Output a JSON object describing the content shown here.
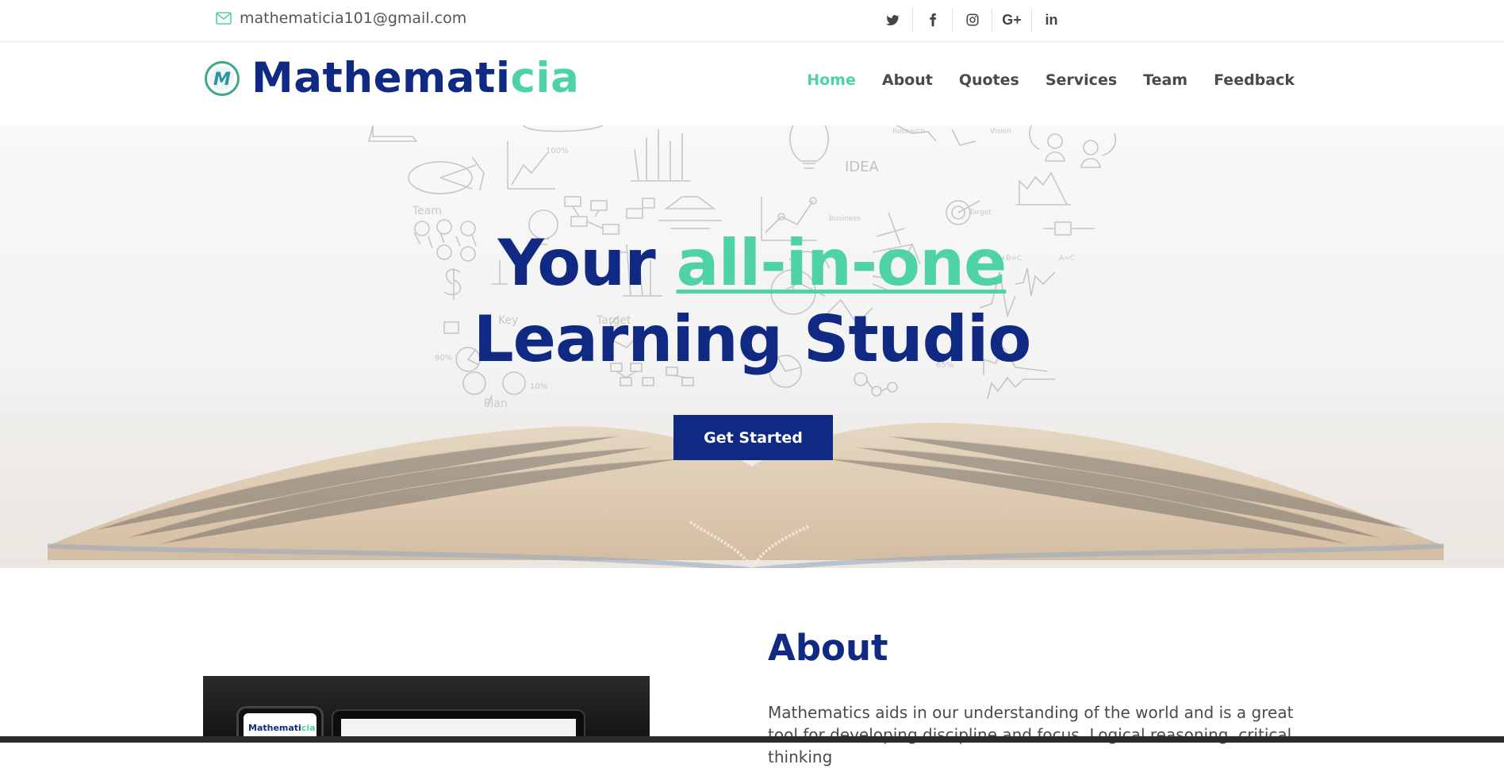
{
  "topbar": {
    "email": "mathematicia101@gmail.com",
    "social": [
      {
        "icon": "twitter-icon",
        "glyph": ""
      },
      {
        "icon": "facebook-icon",
        "glyph": ""
      },
      {
        "icon": "instagram-icon",
        "glyph": ""
      },
      {
        "icon": "google-plus-icon",
        "glyph": "G+"
      },
      {
        "icon": "linkedin-icon",
        "glyph": "in"
      }
    ]
  },
  "brand": {
    "name_main": "Mathemati",
    "name_accent": "cia",
    "primary_color": "#102a83",
    "accent_color": "#4fd2a6"
  },
  "nav": {
    "items": [
      "Home",
      "About",
      "Quotes",
      "Services",
      "Team",
      "Feedback"
    ],
    "active": "Home"
  },
  "hero": {
    "title_part1": "Your",
    "title_highlight": "all-in-one",
    "title_line2": "Learning Studio",
    "cta_label": "Get Started",
    "sketch_words": [
      "Team",
      "IDEA",
      "Plan",
      "Target",
      "Key",
      "Research",
      "Vision",
      "Business",
      "Target"
    ]
  },
  "about": {
    "heading": "About",
    "text": "Mathematics aids in our understanding of the world and is a great tool for developing discipline and focus. Logical reasoning, critical thinking",
    "device_brand_main": "Mathemati",
    "device_brand_accent": "cia"
  }
}
